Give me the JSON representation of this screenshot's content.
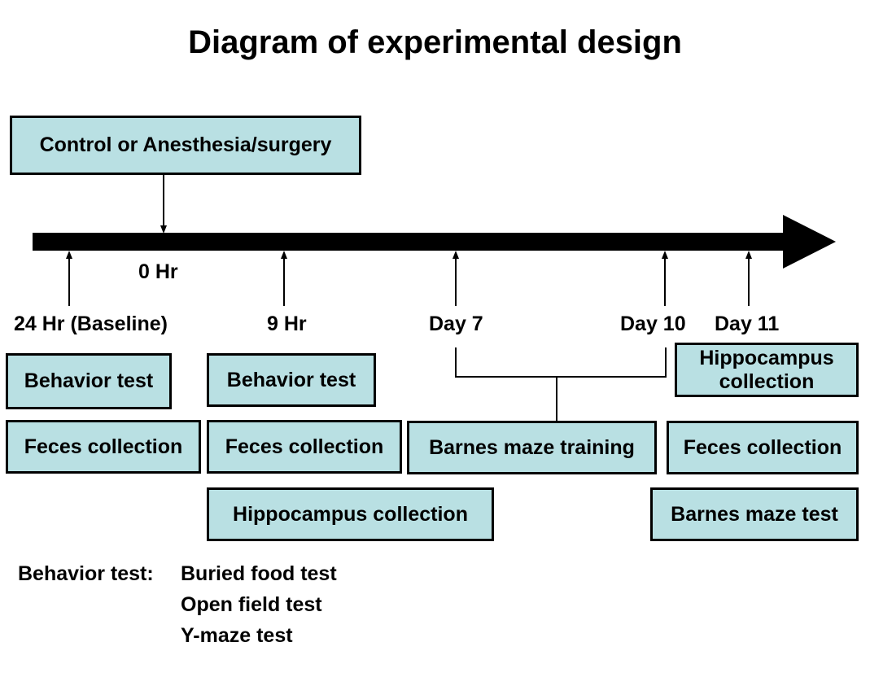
{
  "title": "Diagram of experimental design",
  "top_box": "Control or Anesthesia/surgery",
  "timepoints": {
    "zero": "0 Hr",
    "baseline": "24 Hr (Baseline)",
    "nine": "9 Hr",
    "day7": "Day 7",
    "day10": "Day 10",
    "day11": "Day 11"
  },
  "boxes": {
    "baseline_behavior": "Behavior test",
    "baseline_feces": "Feces collection",
    "nine_behavior": "Behavior test",
    "nine_feces": "Feces collection",
    "nine_hippocampus": "Hippocampus collection",
    "barnes_training": "Barnes maze training",
    "day11_hippocampus": "Hippocampus collection",
    "day11_feces": "Feces collection",
    "day11_barnes_test": "Barnes maze test"
  },
  "legend": {
    "heading": "Behavior test:",
    "items": [
      "Buried food test",
      "Open field test",
      "Y-maze test"
    ]
  },
  "colors": {
    "box_fill": "#b9e0e3",
    "line": "#000000"
  }
}
